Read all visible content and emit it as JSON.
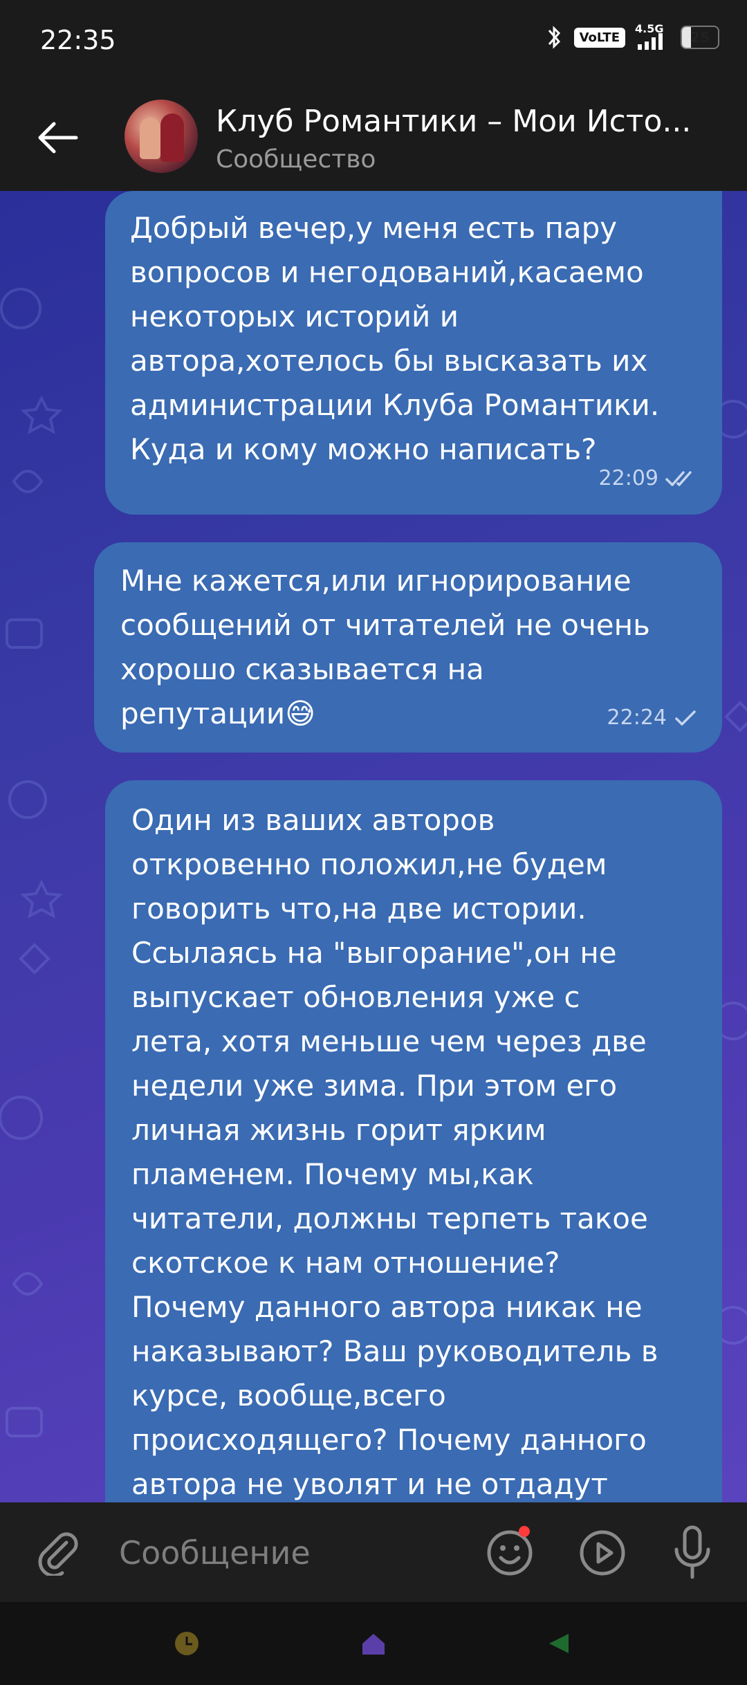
{
  "status_bar": {
    "time": "22:35",
    "volte": "VoLTE",
    "network": "4.5G",
    "battery": "25",
    "battery_level": 0.25
  },
  "header": {
    "title": "Клуб Романтики – Мои Исто...",
    "subtitle": "Сообщество"
  },
  "messages": [
    {
      "text": "Добрый вечер,у меня есть пару\nвопросов и негодований,касаемо\nнекоторых историй и\nавтора,хотелось бы высказать их\nадминистрации Клуба Романтики.\nКуда и кому можно написать?",
      "time": "22:09",
      "status": "read"
    },
    {
      "text": "Мне кажется,или игнорирование\nсообщений от читателей не очень\nхорошо сказывается на\nрепутации😅",
      "time": "22:24",
      "status": "sent"
    },
    {
      "text": "Один из ваших авторов\nоткровенно положил,не будем\nговорить что,на две истории.\nСсылаясь на \"выгорание\",он не\nвыпускает обновления уже с\nлета, хотя меньше чем через две\nнедели уже зима. При этом его\nличная жизнь горит ярким\nпламенем. Почему мы,как\nчитатели, должны терпеть такое\nскотское к нам отношение?\nПочему данного автора никак не\nнаказывают? Ваш руководитель в\nкурсе, вообще,всего\nпроисходящего? Почему данного\nавтора не уволят и не отдадут"
    }
  ],
  "composer": {
    "placeholder": "Сообщение"
  },
  "colors": {
    "bubble": "#3a6bb3",
    "bar": "#1b1b1b",
    "chat_bg_start": "#2a2f9a",
    "chat_bg_end": "#5a44be",
    "notification_dot": "#ff3b3b"
  },
  "icons": {
    "back": "arrow-left-icon",
    "attach": "paperclip-icon",
    "emoji": "smiley-icon",
    "video": "play-circle-icon",
    "mic": "microphone-icon"
  }
}
